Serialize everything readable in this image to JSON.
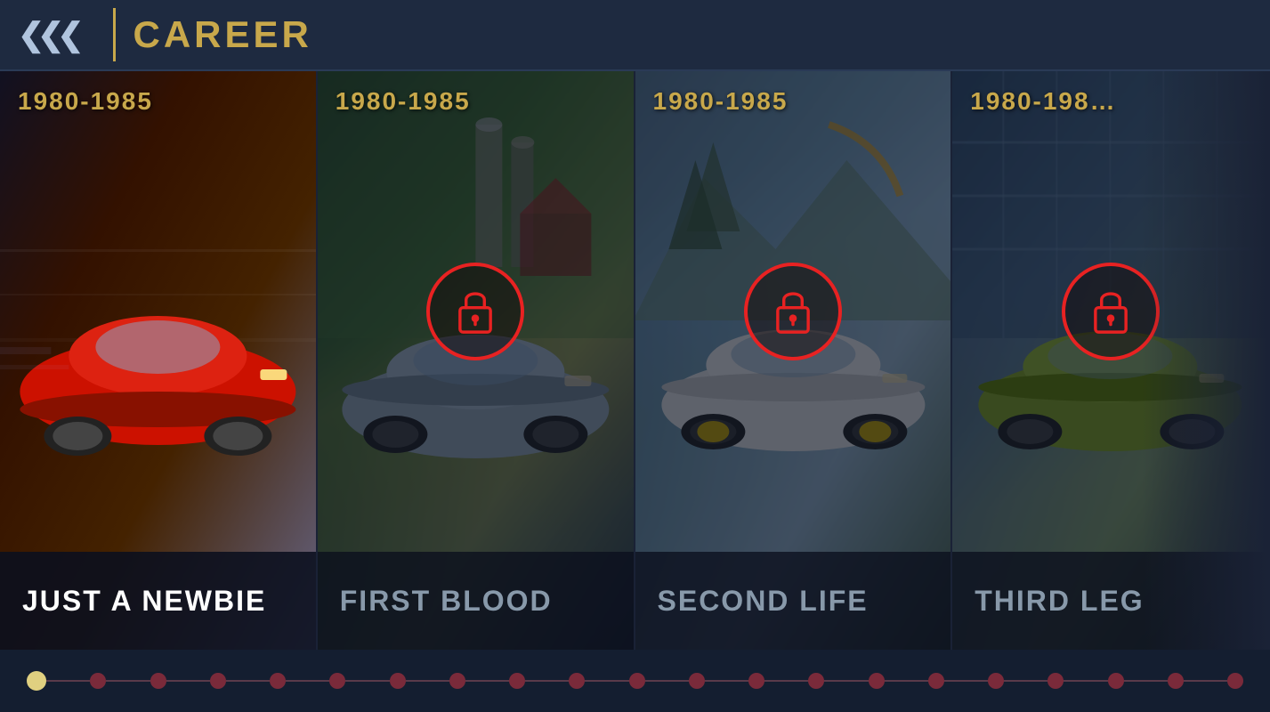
{
  "header": {
    "back_label": "«««",
    "divider_visible": true,
    "title": "CAREER"
  },
  "cards": [
    {
      "id": "card-1",
      "year": "1980-1985",
      "label": "JUST A NEWBIE",
      "locked": false,
      "partial": false
    },
    {
      "id": "card-2",
      "year": "1980-1985",
      "label": "FIRST BLOOD",
      "locked": true,
      "partial": false
    },
    {
      "id": "card-3",
      "year": "1980-1985",
      "label": "SECOND LIFE",
      "locked": true,
      "partial": false
    },
    {
      "id": "card-4",
      "year": "1980-198…",
      "label": "THIRD LEG",
      "locked": true,
      "partial": true
    }
  ],
  "timeline": {
    "dots": [
      {
        "active": true
      },
      {
        "active": false
      },
      {
        "active": false
      },
      {
        "active": false
      },
      {
        "active": false
      },
      {
        "active": false
      },
      {
        "active": false
      },
      {
        "active": false
      },
      {
        "active": false
      },
      {
        "active": false
      },
      {
        "active": false
      },
      {
        "active": false
      },
      {
        "active": false
      },
      {
        "active": false
      },
      {
        "active": false
      },
      {
        "active": false
      },
      {
        "active": false
      },
      {
        "active": false
      },
      {
        "active": false
      },
      {
        "active": false
      },
      {
        "active": false
      }
    ]
  },
  "lock_icon": "🔒"
}
